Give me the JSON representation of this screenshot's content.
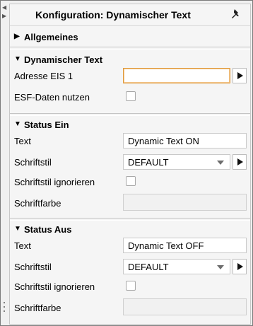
{
  "panel": {
    "title": "Konfiguration: Dynamischer Text",
    "icons": {
      "pin": "pin-icon",
      "collapse_left": "collapse-left-icon",
      "collapse_right": "collapse-right-icon"
    }
  },
  "sections": {
    "allgemeines": {
      "label": "Allgemeines",
      "expanded": false
    },
    "dynamischer_text": {
      "label": "Dynamischer Text",
      "expanded": true,
      "address_label": "Adresse EIS 1",
      "address_value": "",
      "esf_label": "ESF-Daten nutzen",
      "esf_checked": false
    },
    "status_ein": {
      "label": "Status Ein",
      "expanded": true,
      "text_label": "Text",
      "text_value": "Dynamic Text ON",
      "style_label": "Schriftstil",
      "style_value": "DEFAULT",
      "ignore_label": "Schriftstil ignorieren",
      "ignore_checked": false,
      "color_label": "Schriftfarbe",
      "color_value": ""
    },
    "status_aus": {
      "label": "Status Aus",
      "expanded": true,
      "text_label": "Text",
      "text_value": "Dynamic Text OFF",
      "style_label": "Schriftstil",
      "style_value": "DEFAULT",
      "ignore_label": "Schriftstil ignorieren",
      "ignore_checked": false,
      "color_label": "Schriftfarbe",
      "color_value": ""
    }
  },
  "colors": {
    "focus_border": "#e09b3d",
    "panel_bg": "#f5f5f5",
    "field_border": "#c9c9c9"
  }
}
